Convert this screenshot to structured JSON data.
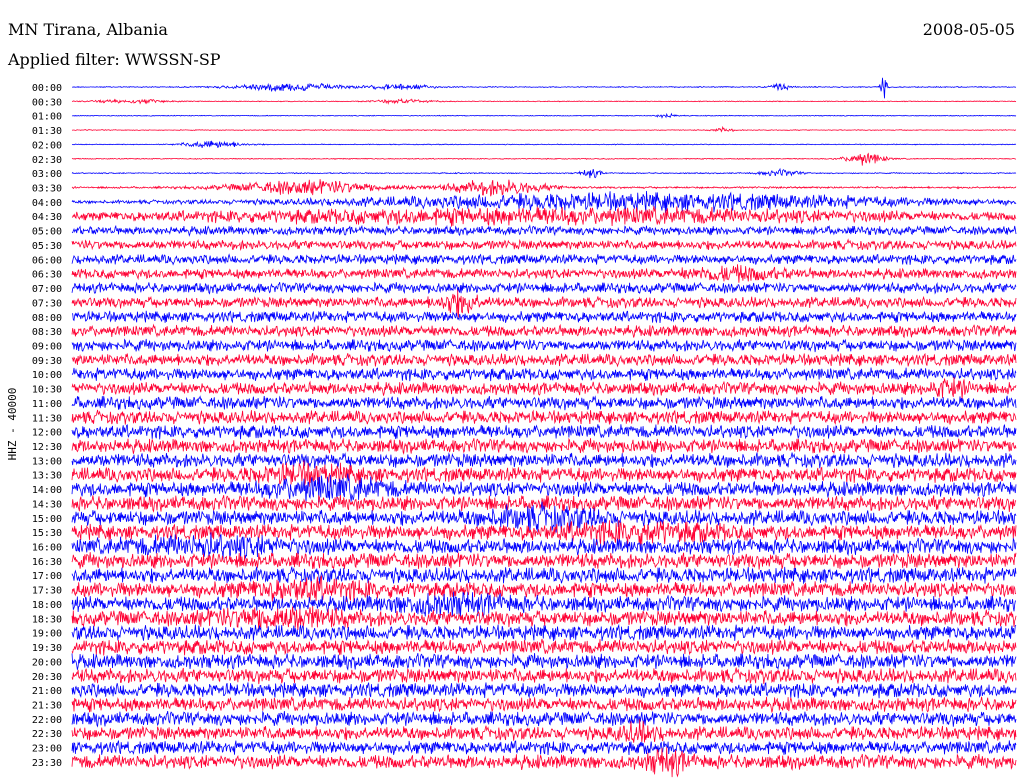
{
  "header": {
    "station": "MN Tirana, Albania",
    "date": "2008-05-05",
    "filter": "Applied filter: WWSSN-SP"
  },
  "chart_data": {
    "type": "line",
    "ylabel": "HHZ - 40000",
    "colors": [
      "#0000ff",
      "#ff0033"
    ],
    "rows": [
      {
        "label": "00:00",
        "noise": 0.06,
        "events": [
          {
            "pos": 0.23,
            "amp": 0.5,
            "width": 0.06
          },
          {
            "pos": 0.35,
            "amp": 0.35,
            "width": 0.03
          },
          {
            "pos": 0.75,
            "amp": 0.5,
            "width": 0.01
          },
          {
            "pos": 0.86,
            "amp": 2.6,
            "width": 0.003
          }
        ]
      },
      {
        "label": "00:30",
        "noise": 0.05,
        "events": [
          {
            "pos": 0.06,
            "amp": 0.25,
            "width": 0.04
          },
          {
            "pos": 0.35,
            "amp": 0.25,
            "width": 0.03
          }
        ]
      },
      {
        "label": "01:00",
        "noise": 0.05,
        "events": [
          {
            "pos": 0.63,
            "amp": 0.3,
            "width": 0.01
          }
        ]
      },
      {
        "label": "01:30",
        "noise": 0.05,
        "events": [
          {
            "pos": 0.69,
            "amp": 0.3,
            "width": 0.01
          }
        ]
      },
      {
        "label": "02:00",
        "noise": 0.05,
        "events": [
          {
            "pos": 0.15,
            "amp": 0.5,
            "width": 0.03
          }
        ]
      },
      {
        "label": "02:30",
        "noise": 0.06,
        "events": [
          {
            "pos": 0.84,
            "amp": 0.8,
            "width": 0.02
          }
        ]
      },
      {
        "label": "03:00",
        "noise": 0.07,
        "events": [
          {
            "pos": 0.55,
            "amp": 0.6,
            "width": 0.01
          },
          {
            "pos": 0.75,
            "amp": 0.4,
            "width": 0.02
          }
        ]
      },
      {
        "label": "03:30",
        "noise": 0.12,
        "events": [
          {
            "pos": 0.25,
            "amp": 0.9,
            "width": 0.08
          },
          {
            "pos": 0.45,
            "amp": 1.0,
            "width": 0.05
          }
        ]
      },
      {
        "label": "04:00",
        "noise": 0.18,
        "events": [
          {
            "pos": 0.6,
            "amp": 1.1,
            "width": 0.3
          }
        ]
      },
      {
        "label": "04:30",
        "noise": 0.35,
        "events": [
          {
            "pos": 0.5,
            "amp": 0.9,
            "width": 0.4
          }
        ]
      },
      {
        "label": "05:00",
        "noise": 0.55,
        "events": []
      },
      {
        "label": "05:30",
        "noise": 0.6,
        "events": []
      },
      {
        "label": "06:00",
        "noise": 0.62,
        "events": []
      },
      {
        "label": "06:30",
        "noise": 0.64,
        "events": [
          {
            "pos": 0.7,
            "amp": 0.6,
            "width": 0.05
          }
        ]
      },
      {
        "label": "07:00",
        "noise": 0.66,
        "events": []
      },
      {
        "label": "07:30",
        "noise": 0.68,
        "events": [
          {
            "pos": 0.41,
            "amp": 1.2,
            "width": 0.02
          }
        ]
      },
      {
        "label": "08:00",
        "noise": 0.7,
        "events": []
      },
      {
        "label": "08:30",
        "noise": 0.72,
        "events": []
      },
      {
        "label": "09:00",
        "noise": 0.74,
        "events": []
      },
      {
        "label": "09:30",
        "noise": 0.76,
        "events": []
      },
      {
        "label": "10:00",
        "noise": 0.78,
        "events": []
      },
      {
        "label": "10:30",
        "noise": 0.8,
        "events": [
          {
            "pos": 0.93,
            "amp": 0.8,
            "width": 0.02
          }
        ]
      },
      {
        "label": "11:00",
        "noise": 0.82,
        "events": []
      },
      {
        "label": "11:30",
        "noise": 0.84,
        "events": []
      },
      {
        "label": "12:00",
        "noise": 0.86,
        "events": []
      },
      {
        "label": "12:30",
        "noise": 0.88,
        "events": []
      },
      {
        "label": "13:00",
        "noise": 0.9,
        "events": []
      },
      {
        "label": "13:30",
        "noise": 0.92,
        "events": [
          {
            "pos": 0.25,
            "amp": 0.8,
            "width": 0.05
          }
        ]
      },
      {
        "label": "14:00",
        "noise": 0.94,
        "events": [
          {
            "pos": 0.27,
            "amp": 1.0,
            "width": 0.06
          }
        ]
      },
      {
        "label": "14:30",
        "noise": 0.95,
        "events": []
      },
      {
        "label": "15:00",
        "noise": 0.96,
        "events": [
          {
            "pos": 0.5,
            "amp": 0.9,
            "width": 0.06
          }
        ]
      },
      {
        "label": "15:30",
        "noise": 0.97,
        "events": [
          {
            "pos": 0.6,
            "amp": 0.8,
            "width": 0.08
          }
        ]
      },
      {
        "label": "16:00",
        "noise": 0.98,
        "events": [
          {
            "pos": 0.15,
            "amp": 0.8,
            "width": 0.08
          }
        ]
      },
      {
        "label": "16:30",
        "noise": 0.98,
        "events": []
      },
      {
        "label": "17:00",
        "noise": 0.98,
        "events": []
      },
      {
        "label": "17:30",
        "noise": 0.98,
        "events": [
          {
            "pos": 0.25,
            "amp": 0.8,
            "width": 0.06
          }
        ]
      },
      {
        "label": "18:00",
        "noise": 0.98,
        "events": [
          {
            "pos": 0.4,
            "amp": 0.8,
            "width": 0.06
          }
        ]
      },
      {
        "label": "18:30",
        "noise": 0.98,
        "events": [
          {
            "pos": 0.22,
            "amp": 1.0,
            "width": 0.06
          }
        ]
      },
      {
        "label": "19:00",
        "noise": 0.96,
        "events": []
      },
      {
        "label": "19:30",
        "noise": 0.95,
        "events": []
      },
      {
        "label": "20:00",
        "noise": 0.94,
        "events": []
      },
      {
        "label": "20:30",
        "noise": 0.93,
        "events": []
      },
      {
        "label": "21:00",
        "noise": 0.92,
        "events": []
      },
      {
        "label": "21:30",
        "noise": 0.9,
        "events": []
      },
      {
        "label": "22:00",
        "noise": 0.88,
        "events": []
      },
      {
        "label": "22:30",
        "noise": 0.86,
        "events": [
          {
            "pos": 0.6,
            "amp": 0.8,
            "width": 0.02
          }
        ]
      },
      {
        "label": "23:00",
        "noise": 0.84,
        "events": []
      },
      {
        "label": "23:30",
        "noise": 0.9,
        "events": [
          {
            "pos": 0.63,
            "amp": 1.2,
            "width": 0.02
          }
        ]
      }
    ]
  }
}
